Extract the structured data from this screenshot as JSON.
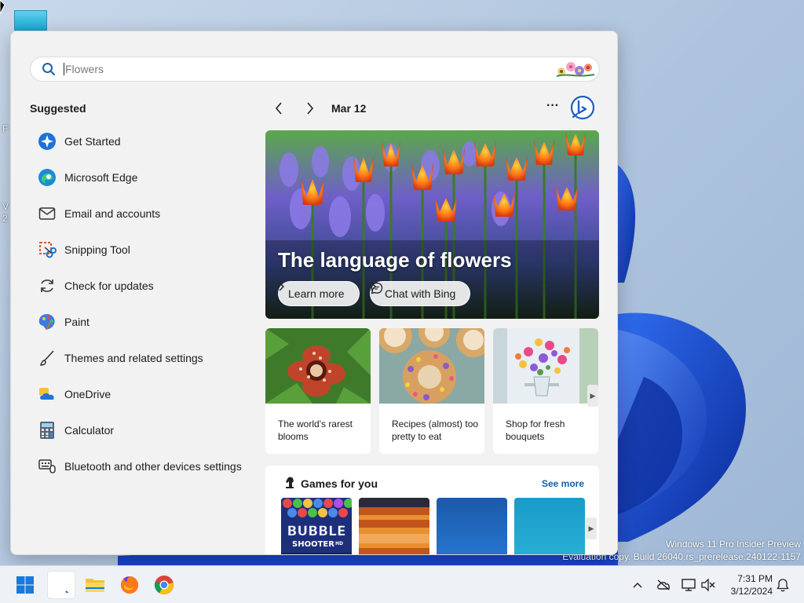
{
  "desktop": {
    "fragment_1": "F",
    "fragment_2": "V",
    "fragment_3": "2",
    "watermark_line1": "Windows 11 Pro Insider Preview",
    "watermark_line2": "Evaluation copy. Build 26040.rs_prerelease.240122-1157"
  },
  "search": {
    "placeholder": "Flowers",
    "value": ""
  },
  "suggested": {
    "title": "Suggested",
    "items": [
      {
        "label": "Get Started",
        "icon": "get-started-icon"
      },
      {
        "label": "Microsoft Edge",
        "icon": "edge-icon"
      },
      {
        "label": "Email and accounts",
        "icon": "mail-icon"
      },
      {
        "label": "Snipping Tool",
        "icon": "snipping-tool-icon"
      },
      {
        "label": "Check for updates",
        "icon": "refresh-icon"
      },
      {
        "label": "Paint",
        "icon": "paint-icon"
      },
      {
        "label": "Themes and related settings",
        "icon": "brush-icon"
      },
      {
        "label": "OneDrive",
        "icon": "onedrive-icon"
      },
      {
        "label": "Calculator",
        "icon": "calculator-icon"
      },
      {
        "label": "Bluetooth and other devices settings",
        "icon": "devices-icon"
      }
    ]
  },
  "highlights": {
    "date": "Mar 12",
    "more_label": "···",
    "hero": {
      "title": "The language of flowers",
      "learn_more": "Learn more",
      "chat_with_bing": "Chat with Bing"
    },
    "tiles": [
      {
        "caption": "The world's rarest blooms"
      },
      {
        "caption": "Recipes (almost) too pretty to eat"
      },
      {
        "caption": "Shop for fresh bouquets"
      }
    ],
    "scroll_glyph": "▶"
  },
  "games": {
    "title": "Games for you",
    "see_more": "See more",
    "bubble_line1": "BUBBLE",
    "bubble_line2": "SHOOTER",
    "bubble_badge": "HD"
  },
  "taskbar": {
    "apps": [
      "start-icon",
      "search-icon",
      "file-explorer-icon",
      "firefox-icon",
      "chrome-icon"
    ]
  },
  "tray": {
    "time": "7:31 PM",
    "date": "3/12/2024"
  },
  "colors": {
    "accent": "#0f5fa8",
    "wallpaper_blue": "#1a44c8"
  }
}
